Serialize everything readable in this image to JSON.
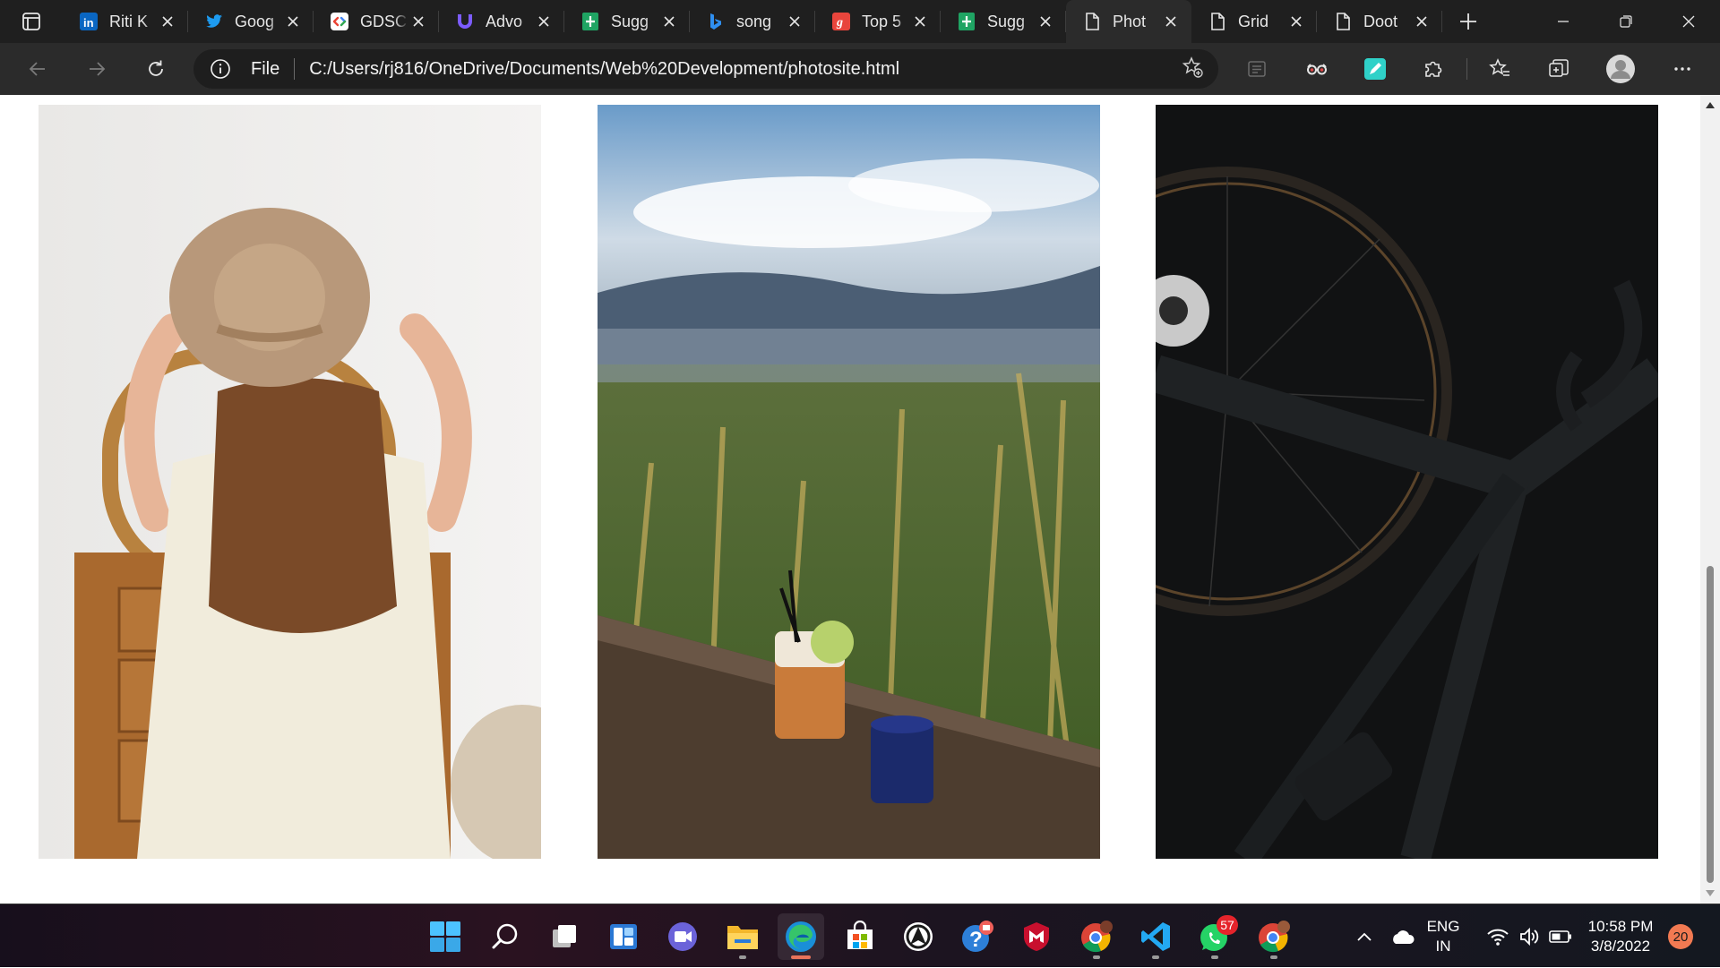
{
  "browser": {
    "tabs": [
      {
        "title": "Riti K",
        "icon": "linkedin-icon",
        "active": false
      },
      {
        "title": "Goog",
        "icon": "twitter-icon",
        "active": false
      },
      {
        "title": "GDSC",
        "icon": "gdsc-icon",
        "active": false
      },
      {
        "title": "Advo",
        "icon": "magnet-icon",
        "active": false
      },
      {
        "title": "Sugg",
        "icon": "google-sheets-icon",
        "active": false
      },
      {
        "title": "song",
        "icon": "bing-icon",
        "active": false
      },
      {
        "title": "Top 5",
        "icon": "g-letter-icon",
        "active": false
      },
      {
        "title": "Sugg",
        "icon": "google-sheets-icon",
        "active": false
      },
      {
        "title": "Phot",
        "icon": "page-icon",
        "active": true
      },
      {
        "title": "Grid",
        "icon": "page-icon",
        "active": false
      },
      {
        "title": "Doot",
        "icon": "page-icon",
        "active": false
      }
    ],
    "address": {
      "scheme_label": "File",
      "url": "C:/Users/rj816/OneDrive/Documents/Web%20Development/photosite.html"
    }
  },
  "page": {
    "photos": [
      {
        "subject": "woman-in-hat-photo"
      },
      {
        "subject": "drink-on-railing-photo"
      },
      {
        "subject": "black-bicycle-photo"
      }
    ]
  },
  "taskbar": {
    "apps": [
      {
        "name": "start-icon"
      },
      {
        "name": "search-icon"
      },
      {
        "name": "task-view-icon"
      },
      {
        "name": "widgets-icon"
      },
      {
        "name": "teams-chat-icon"
      },
      {
        "name": "file-explorer-icon"
      },
      {
        "name": "edge-icon"
      },
      {
        "name": "microsoft-store-icon"
      },
      {
        "name": "github-icon"
      },
      {
        "name": "get-help-icon"
      },
      {
        "name": "mcafee-icon"
      },
      {
        "name": "chrome-profile-icon"
      },
      {
        "name": "vscode-icon"
      },
      {
        "name": "whatsapp-icon",
        "badge": "57"
      },
      {
        "name": "chrome-icon"
      }
    ],
    "tray": {
      "language_line1": "ENG",
      "language_line2": "IN",
      "time": "10:58 PM",
      "date": "3/8/2022",
      "notifications": "20"
    }
  },
  "colors": {
    "tabstrip": "#1f1f1f",
    "toolbar": "#2b2b2b",
    "omnibox": "#1e1e1e",
    "edge_indicator": "#e8735a",
    "badge": "#e5242b"
  }
}
